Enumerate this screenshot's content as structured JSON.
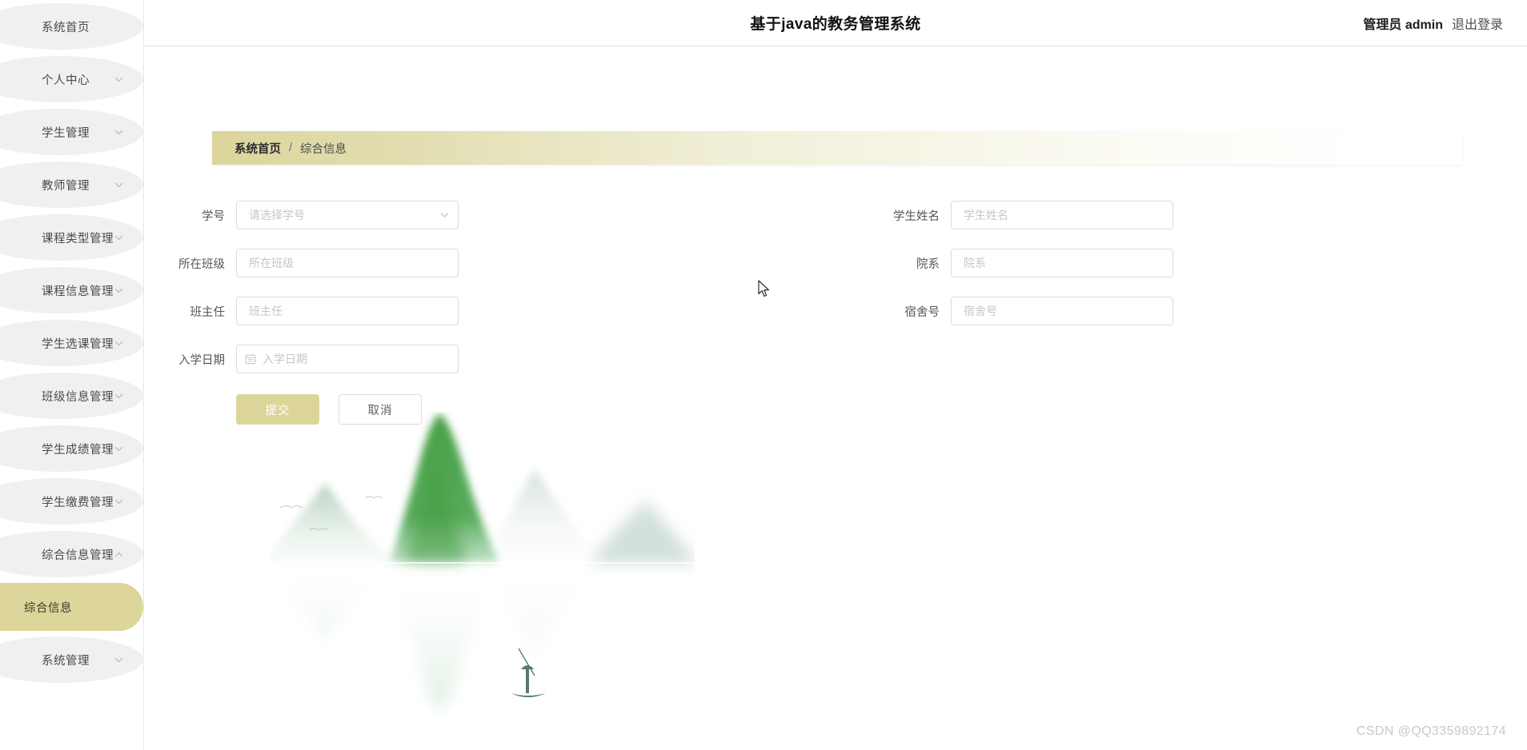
{
  "header": {
    "title": "基于java的教务管理系统",
    "user_label": "管理员 admin",
    "logout_label": "退出登录"
  },
  "sidebar": {
    "items": [
      {
        "label": "系统首页",
        "arrow": "none",
        "active": false
      },
      {
        "label": "个人中心",
        "arrow": "chevron-down",
        "active": false
      },
      {
        "label": "学生管理",
        "arrow": "chevron-down",
        "active": false
      },
      {
        "label": "教师管理",
        "arrow": "chevron-down",
        "active": false
      },
      {
        "label": "课程类型管理",
        "arrow": "chevron-down",
        "active": false
      },
      {
        "label": "课程信息管理",
        "arrow": "chevron-down",
        "active": false
      },
      {
        "label": "学生选课管理",
        "arrow": "chevron-down",
        "active": false
      },
      {
        "label": "班级信息管理",
        "arrow": "chevron-down",
        "active": false
      },
      {
        "label": "学生成绩管理",
        "arrow": "chevron-down",
        "active": false
      },
      {
        "label": "学生缴费管理",
        "arrow": "chevron-down",
        "active": false
      },
      {
        "label": "综合信息管理",
        "arrow": "chevron-up",
        "active": false
      },
      {
        "label": "综合信息",
        "arrow": "none",
        "active": true
      },
      {
        "label": "系统管理",
        "arrow": "chevron-down",
        "active": false
      }
    ]
  },
  "breadcrumb": {
    "home": "系统首页",
    "separator": "/",
    "current": "综合信息"
  },
  "form": {
    "fields": {
      "student_id": {
        "label": "学号",
        "placeholder": "请选择学号",
        "value": "",
        "type": "select"
      },
      "student_name": {
        "label": "学生姓名",
        "placeholder": "学生姓名",
        "value": "",
        "type": "text"
      },
      "class_name": {
        "label": "所在班级",
        "placeholder": "所在班级",
        "value": "",
        "type": "text"
      },
      "department": {
        "label": "院系",
        "placeholder": "院系",
        "value": "",
        "type": "text"
      },
      "head_teacher": {
        "label": "班主任",
        "placeholder": "班主任",
        "value": "",
        "type": "text"
      },
      "dorm_number": {
        "label": "宿舍号",
        "placeholder": "宿舍号",
        "value": "",
        "type": "text"
      },
      "enroll_date": {
        "label": "入学日期",
        "placeholder": "入学日期",
        "value": "",
        "type": "date"
      }
    },
    "submit_label": "提交",
    "cancel_label": "取消"
  },
  "watermark": "CSDN @QQ3359892174",
  "colors": {
    "accent": "#dcd59a",
    "sidebar_item_bg": "#f0f0f0",
    "border": "#dcdcdc",
    "placeholder": "#c6c6c6"
  }
}
